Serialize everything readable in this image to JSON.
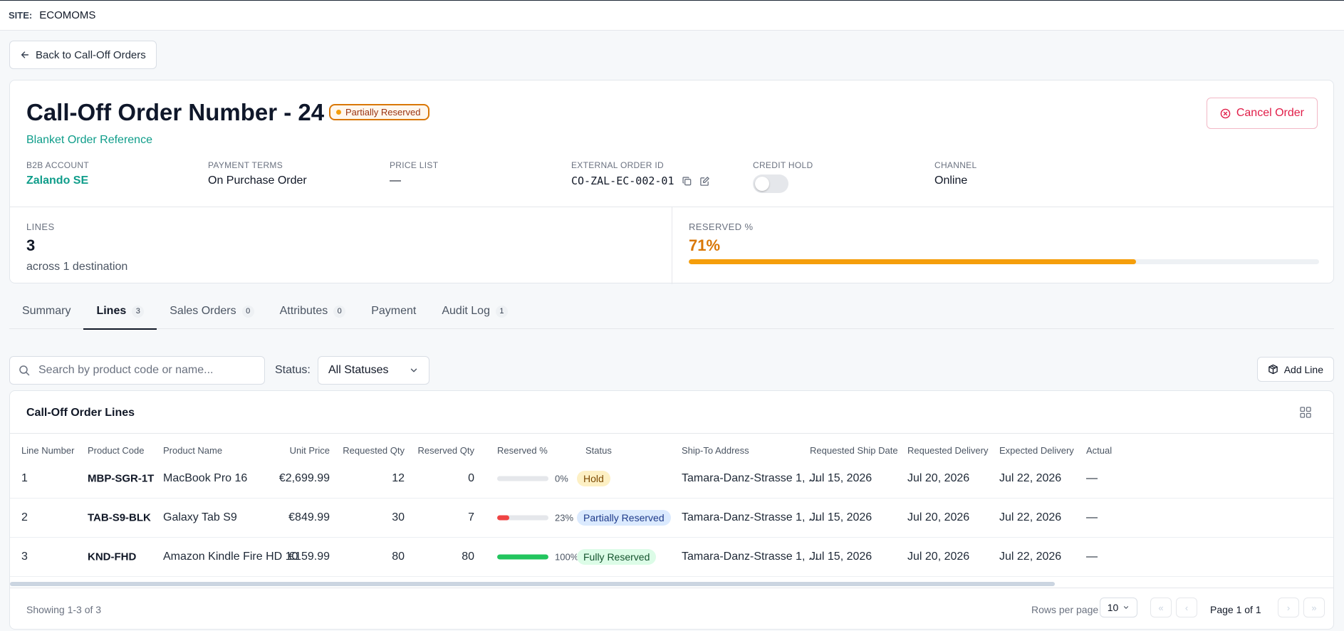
{
  "topbar": {
    "site_label": "SITE:",
    "site_value": "ECOMOMS"
  },
  "back_button": {
    "label": "Back to Call-Off Orders"
  },
  "header": {
    "title": "Call-Off Order Number - 24",
    "status_badge": "Partially Reserved",
    "blanket_link": "Blanket Order Reference",
    "cancel_label": "Cancel Order",
    "meta": {
      "b2b_account": {
        "label": "B2B ACCOUNT",
        "value": "Zalando SE"
      },
      "payment_terms": {
        "label": "PAYMENT TERMS",
        "value": "On Purchase Order"
      },
      "price_list": {
        "label": "PRICE LIST",
        "value": "—"
      },
      "external_order_id": {
        "label": "EXTERNAL ORDER ID",
        "value": "CO-ZAL-EC-002-01"
      },
      "credit_hold": {
        "label": "CREDIT HOLD",
        "on": false
      },
      "channel": {
        "label": "CHANNEL",
        "value": "Online"
      }
    }
  },
  "stats": {
    "lines": {
      "label": "LINES",
      "value": "3",
      "sub": "across 1 destination"
    },
    "reserved": {
      "label": "RESERVED %",
      "value": "71%",
      "fraction": 0.71,
      "color": "#f59e0b"
    }
  },
  "tabs": [
    {
      "label": "Summary",
      "count": ""
    },
    {
      "label": "Lines",
      "count": "3",
      "active": true
    },
    {
      "label": "Sales Orders",
      "count": "0"
    },
    {
      "label": "Attributes",
      "count": "0"
    },
    {
      "label": "Payment",
      "count": ""
    },
    {
      "label": "Audit Log",
      "count": "1"
    }
  ],
  "filters": {
    "search_placeholder": "Search by product code or name...",
    "status_label": "Status:",
    "status_value": "All Statuses",
    "add_line_label": "Add Line"
  },
  "table": {
    "title": "Call-Off Order Lines",
    "columns": [
      "Line Number",
      "Product Code",
      "Product Name",
      "Unit Price",
      "Requested Qty",
      "Reserved Qty",
      "Reserved %",
      "Status",
      "Ship-To Address",
      "Requested Ship Date",
      "Requested Delivery",
      "Expected Delivery",
      "Actual"
    ],
    "rows": [
      {
        "line": "1",
        "code": "MBP-SGR-1T",
        "name": "MacBook Pro 16",
        "price": "€2,699.99",
        "req_qty": "12",
        "res_qty": "0",
        "res_pct": "0%",
        "res_fraction": 0,
        "bar_color": "#e5e7eb",
        "status": "Hold",
        "status_bg": "#fdf0c4",
        "status_fg": "#7c4a03",
        "address": "Tamara-Danz-Strasse 1, ...",
        "ship_date": "Jul 15, 2026",
        "req_delivery": "Jul 20, 2026",
        "exp_delivery": "Jul 22, 2026",
        "actual": "—"
      },
      {
        "line": "2",
        "code": "TAB-S9-BLK",
        "name": "Galaxy Tab S9",
        "price": "€849.99",
        "req_qty": "30",
        "res_qty": "7",
        "res_pct": "23%",
        "res_fraction": 0.23,
        "bar_color": "#ef4444",
        "status": "Partially Reserved",
        "status_bg": "#dbeafe",
        "status_fg": "#1e3a8a",
        "address": "Tamara-Danz-Strasse 1, ...",
        "ship_date": "Jul 15, 2026",
        "req_delivery": "Jul 20, 2026",
        "exp_delivery": "Jul 22, 2026",
        "actual": "—"
      },
      {
        "line": "3",
        "code": "KND-FHD",
        "name": "Amazon Kindle Fire HD 10",
        "price": "€159.99",
        "req_qty": "80",
        "res_qty": "80",
        "res_pct": "100%",
        "res_fraction": 1,
        "bar_color": "#22c55e",
        "status": "Fully Reserved",
        "status_bg": "#dcfce7",
        "status_fg": "#14532d",
        "address": "Tamara-Danz-Strasse 1, ...",
        "ship_date": "Jul 15, 2026",
        "req_delivery": "Jul 20, 2026",
        "exp_delivery": "Jul 22, 2026",
        "actual": "—"
      }
    ],
    "footer": {
      "showing": "Showing 1-3 of 3",
      "rows_per_page_label": "Rows per page",
      "rows_per_page_value": "10",
      "page_info": "Page 1 of 1"
    }
  }
}
